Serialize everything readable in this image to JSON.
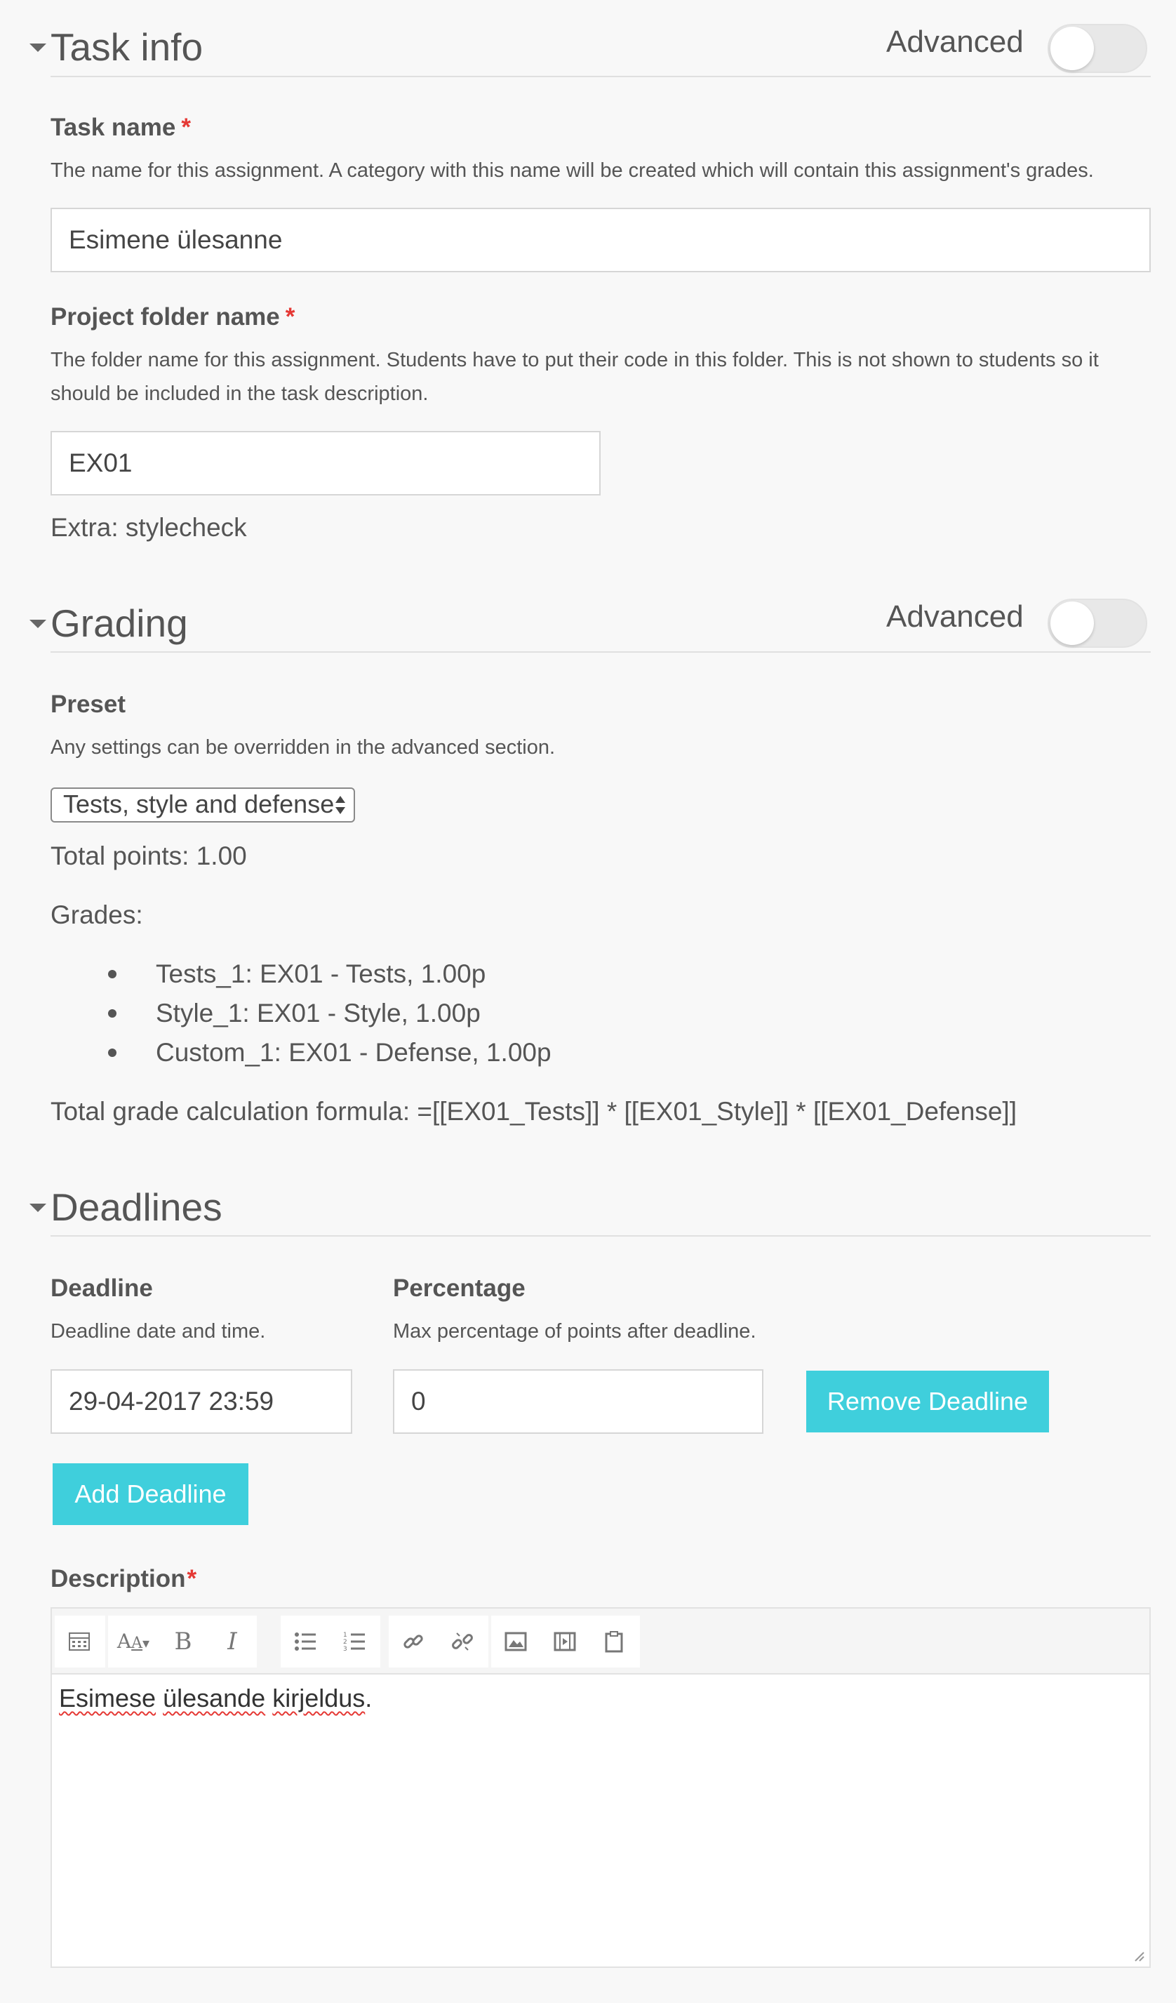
{
  "task_info": {
    "title": "Task info",
    "advanced_label": "Advanced",
    "task_name_label": "Task name",
    "task_name_required": "*",
    "task_name_help": "The name for this assignment. A category with this name will be created which will contain this assignment's grades.",
    "task_name_value": "Esimene ülesanne",
    "folder_label": "Project folder name",
    "folder_required": "*",
    "folder_help_line1": "The folder name for this assignment. Students have to put their code in this folder. This is not shown to students so it",
    "folder_help_line2": "should be included in the task description.",
    "folder_value": "EX01",
    "extra": "Extra: stylecheck"
  },
  "grading": {
    "title": "Grading",
    "advanced_label": "Advanced",
    "preset_label": "Preset",
    "preset_help": "Any settings can be overridden in the advanced section.",
    "preset_value": "Tests, style and defense",
    "total_points": "Total points: 1.00",
    "grades_label": "Grades:",
    "grades": [
      "Tests_1: EX01 - Tests, 1.00p",
      "Style_1: EX01 - Style, 1.00p",
      "Custom_1: EX01 - Defense, 1.00p"
    ],
    "formula": "Total grade calculation formula: =[[EX01_Tests]] * [[EX01_Style]] * [[EX01_Defense]]"
  },
  "deadlines": {
    "title": "Deadlines",
    "deadline_label": "Deadline",
    "deadline_help": "Deadline date and time.",
    "deadline_value": "29-04-2017 23:59",
    "percentage_label": "Percentage",
    "percentage_help": "Max percentage of points after deadline.",
    "percentage_value": "0",
    "remove_button": "Remove Deadline",
    "add_button": "Add Deadline"
  },
  "description": {
    "label": "Description",
    "required": "*",
    "content_word1": "Esimese",
    "content_word2": "ülesande",
    "content_word3": "kirjeldus",
    "content_period": ".",
    "toolbar_icons": [
      "toggle-toolbar-icon",
      "font-style-icon",
      "bold-icon",
      "italic-icon",
      "bullet-list-icon",
      "numbered-list-icon",
      "link-icon",
      "unlink-icon",
      "image-icon",
      "media-icon",
      "paste-icon"
    ]
  },
  "colors": {
    "accent": "#3fcfdc",
    "required": "#e53935"
  }
}
